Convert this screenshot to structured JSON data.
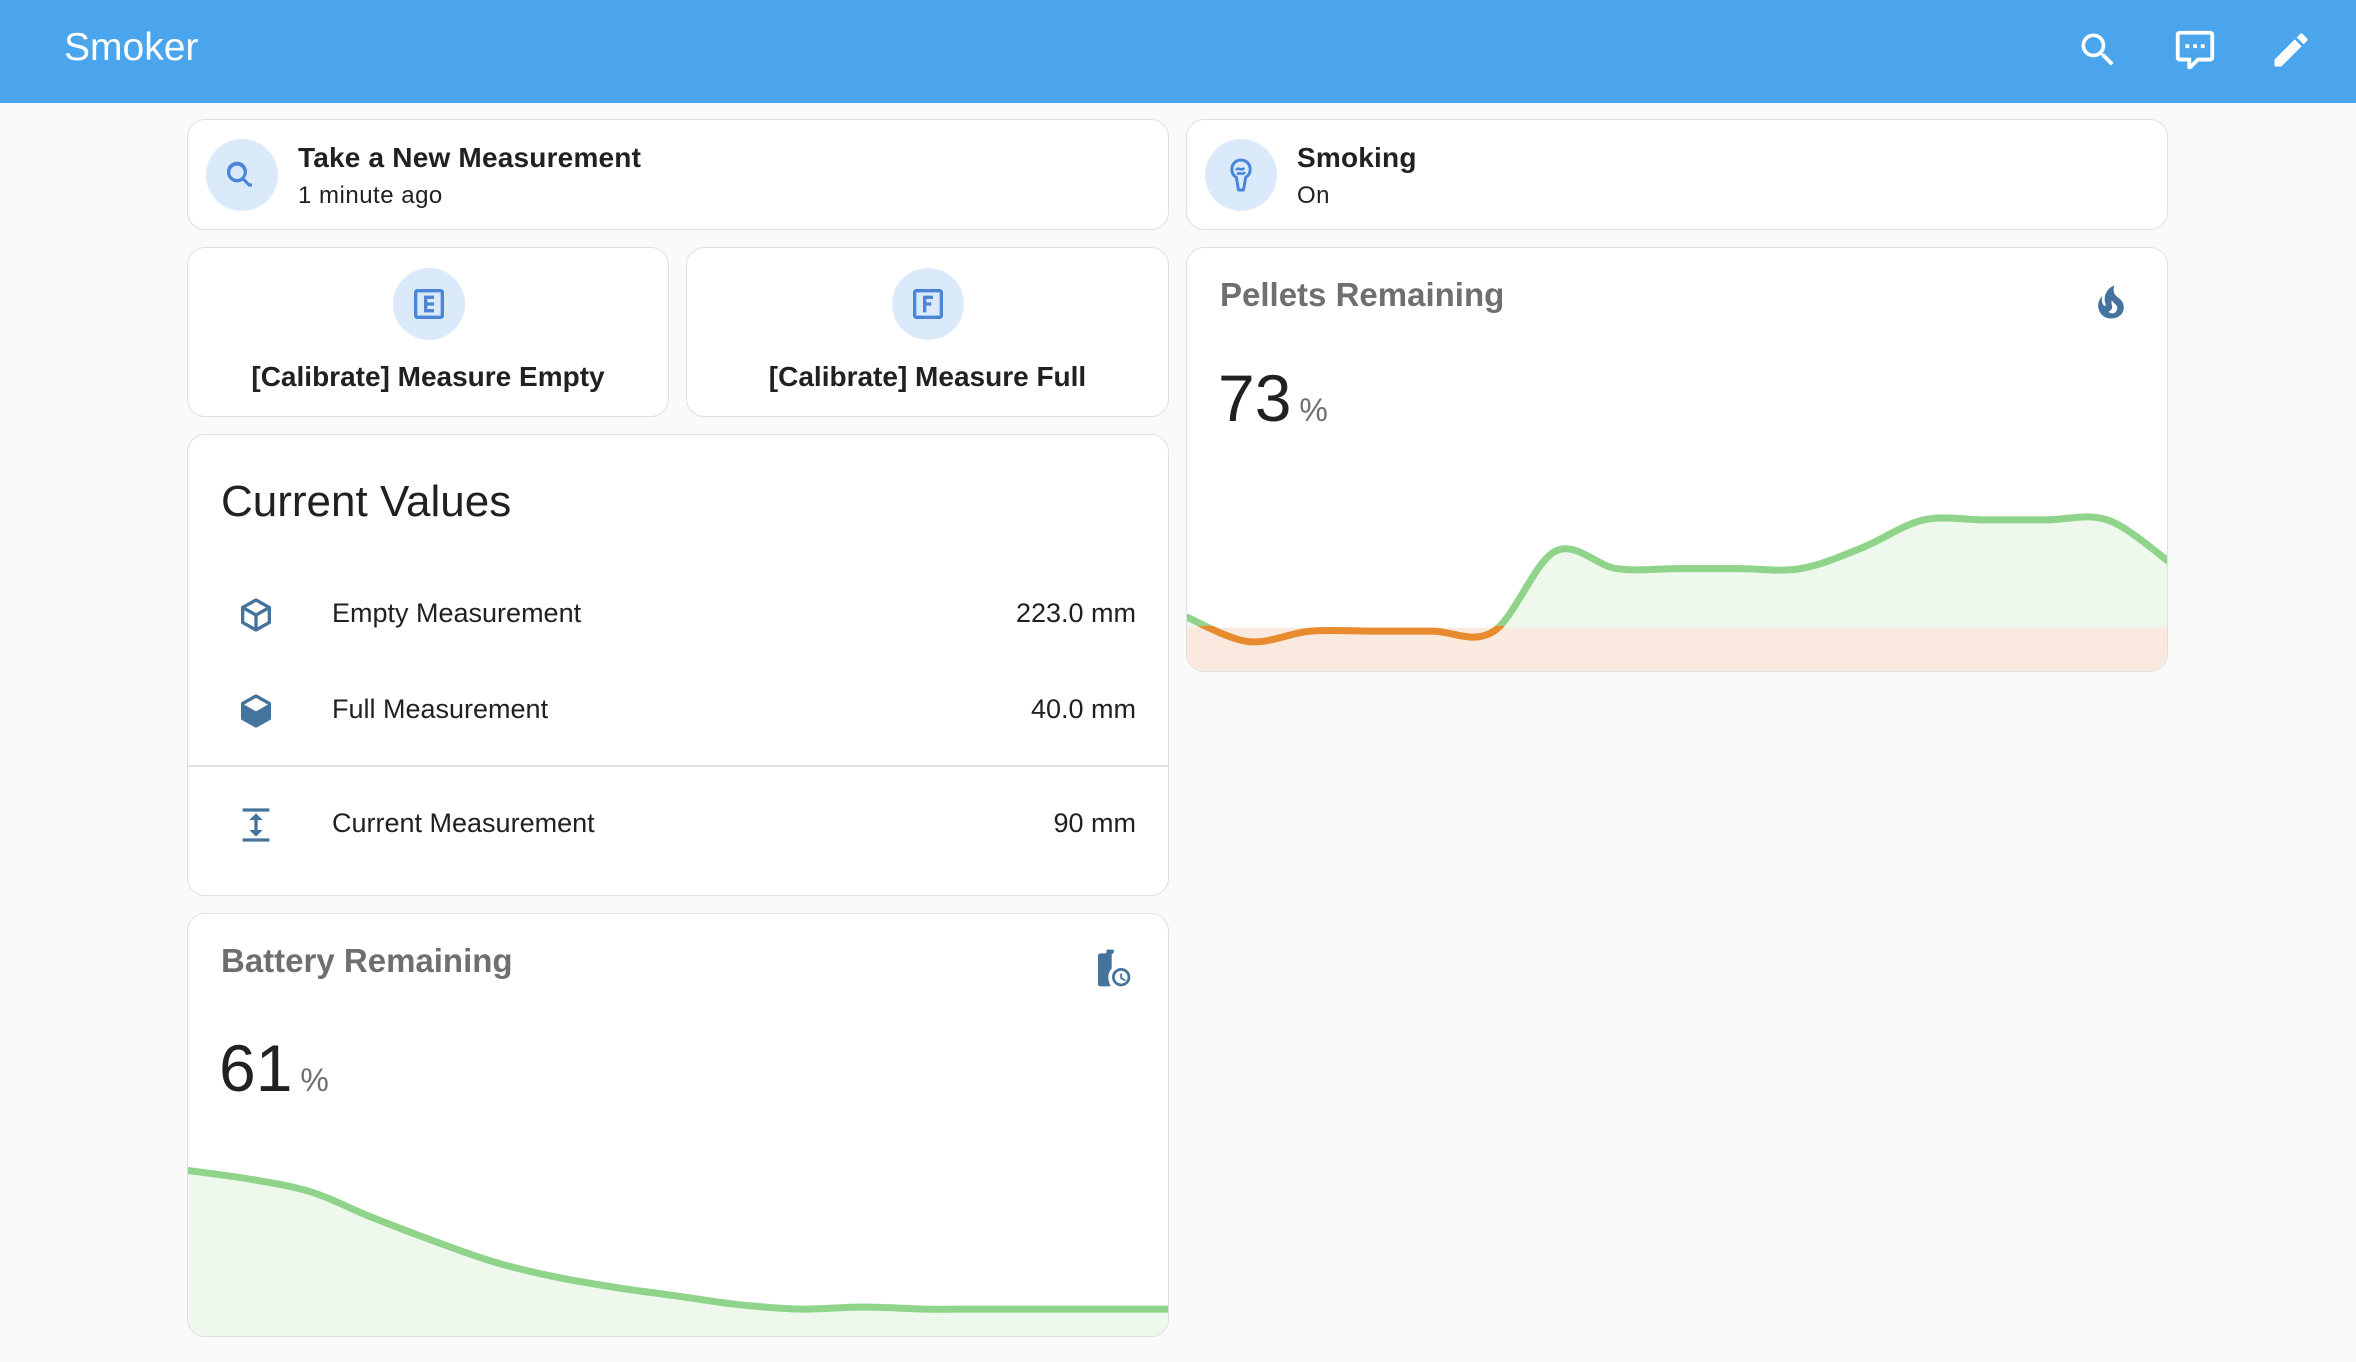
{
  "header": {
    "title": "Smoker",
    "actions": [
      {
        "name": "search-button",
        "icon": "search-icon"
      },
      {
        "name": "assist-button",
        "icon": "chat-icon"
      },
      {
        "name": "edit-button",
        "icon": "pencil-icon"
      }
    ]
  },
  "tiles": {
    "measurement": {
      "name": "Take a New Measurement",
      "state": "1 minute ago",
      "icon": "magnify-scan-icon"
    },
    "smoking": {
      "name": "Smoking",
      "state": "On",
      "icon": "smoking-icon"
    }
  },
  "buttons": {
    "empty": {
      "label": "[Calibrate] Measure Empty",
      "icon": "letter-e-box-icon"
    },
    "full": {
      "label": "[Calibrate] Measure Full",
      "icon": "letter-f-box-icon"
    }
  },
  "entities": {
    "title": "Current Values",
    "rows": [
      {
        "name": "Empty Measurement",
        "value": "223.0 mm",
        "icon": "cube-outline-icon"
      },
      {
        "name": "Full Measurement",
        "value": "40.0 mm",
        "icon": "cube-icon"
      },
      {
        "name": "Current Measurement",
        "value": "90 mm",
        "icon": "arrow-expand-vertical-icon"
      }
    ]
  },
  "pellets": {
    "name": "Pellets Remaining",
    "value": "73",
    "unit": "%",
    "icon": "fire-icon",
    "trend": [
      40,
      33,
      36,
      36,
      36,
      36,
      59,
      54,
      54,
      54,
      54,
      60,
      68,
      68,
      68,
      68,
      56
    ],
    "colors": {
      "line": "#8fd48a",
      "low": "#e88a2e",
      "fill": "#eef8ec",
      "low_fill": "#f9e9df"
    }
  },
  "battery": {
    "name": "Battery Remaining",
    "value": "61",
    "unit": "%",
    "icon": "battery-clock-icon",
    "trend": [
      92,
      88,
      82,
      70,
      59,
      49,
      42,
      37,
      33,
      29,
      27,
      28,
      27,
      27,
      27,
      27,
      27
    ],
    "colors": {
      "line": "#8fd48a",
      "fill": "#eef8ec"
    }
  },
  "theme": {
    "primary": "#4ba5ec",
    "icon_blue": "#4a86d8",
    "icon_dark": "#44739e"
  }
}
